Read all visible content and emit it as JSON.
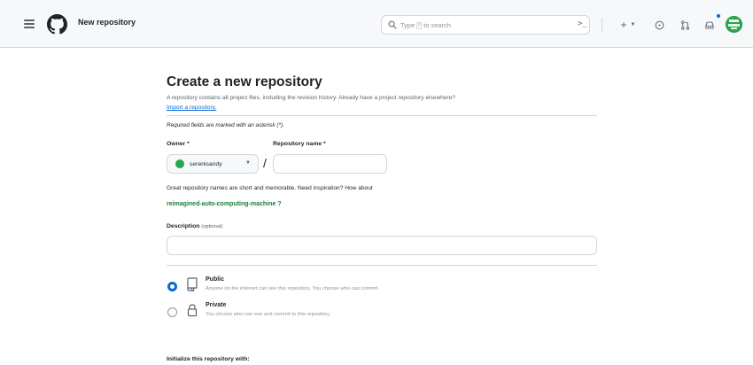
{
  "header": {
    "page_title": "New repository",
    "search_placeholder_prefix": "Type",
    "search_placeholder_key": "/",
    "search_placeholder_suffix": "to search"
  },
  "form": {
    "title": "Create a new repository",
    "intro": "A repository contains all project files, including the revision history. Already have a project repository elsewhere?",
    "import_link": "Import a repository.",
    "required_note": "Required fields are marked with an asterisk (*).",
    "owner_label": "Owner *",
    "owner_value": "serenisandy",
    "repo_label": "Repository name *",
    "repo_value": "",
    "suggestion_text": "Great repository names are short and memorable. Need inspiration? How about",
    "suggestion_name": "reimagined-auto-computing-machine ?",
    "description_label": "Description",
    "description_optional": "(optional)",
    "description_value": "",
    "visibility": [
      {
        "title": "Public",
        "desc": "Anyone on the internet can see this repository. You choose who can commit.",
        "selected": true,
        "icon": "repo-icon"
      },
      {
        "title": "Private",
        "desc": "You choose who can see and commit to this repository.",
        "selected": false,
        "icon": "lock-icon"
      }
    ],
    "init_heading": "Initialize this repository with:"
  },
  "colors": {
    "accent": "#0969da",
    "success": "#1a7f37",
    "avatar": "#2da44e"
  }
}
